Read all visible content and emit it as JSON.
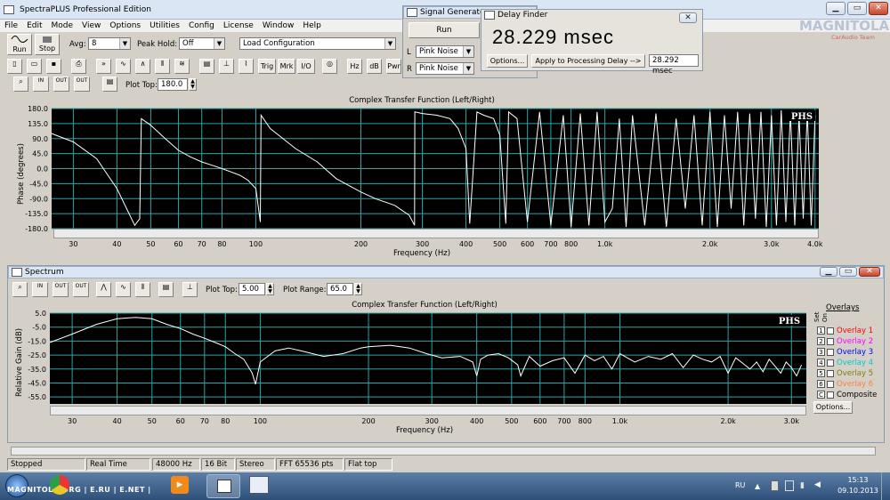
{
  "app": {
    "title": "SpectraPLUS Professional Edition"
  },
  "menu": [
    "File",
    "Edit",
    "Mode",
    "View",
    "Options",
    "Utilities",
    "Config",
    "License",
    "Window",
    "Help"
  ],
  "toolbar": {
    "run_label": "Run",
    "stop_label": "Stop",
    "avg_label": "Avg:",
    "avg_value": "8",
    "peak_hold_label": "Peak Hold:",
    "peak_hold_value": "Off",
    "load_config_value": "Load Configuration",
    "icon_buttons": [
      "Trig",
      "Mrk",
      "I/O",
      "Hz",
      "dB",
      "Pwr"
    ]
  },
  "signal_generator": {
    "title": "Signal Generator",
    "run_label": "Run",
    "left_label": "L",
    "right_label": "R",
    "left_value": "Pink Noise",
    "right_value": "Pink Noise"
  },
  "delay_finder": {
    "title": "Delay Finder",
    "value": "28.229 msec",
    "options_label": "Options...",
    "apply_label": "Apply to Processing Delay -->",
    "apply_value": "28.292 msec"
  },
  "watermark": {
    "line1": "MAGNITOLA",
    "line2": "CarAudio Team"
  },
  "phase_plot": {
    "plot_top_label": "Plot Top:",
    "plot_top_value": "180.0",
    "zoom_buttons": [
      "IN",
      "OUT",
      "OUT"
    ]
  },
  "spectrum": {
    "window_title": "Spectrum",
    "plot_top_label": "Plot Top:",
    "plot_top_value": "5.00",
    "plot_range_label": "Plot Range:",
    "plot_range_value": "65.0",
    "options_label": "Options...",
    "overlays_title": "Overlays",
    "set_label": "Set",
    "on_label": "On",
    "overlays": [
      {
        "set": "1",
        "name": "Overlay 1",
        "color": "#ff0000"
      },
      {
        "set": "2",
        "name": "Overlay 2",
        "color": "#ff00ff"
      },
      {
        "set": "3",
        "name": "Overlay 3",
        "color": "#0000ff"
      },
      {
        "set": "4",
        "name": "Overlay 4",
        "color": "#00c8c8"
      },
      {
        "set": "5",
        "name": "Overlay 5",
        "color": "#808000"
      },
      {
        "set": "6",
        "name": "Overlay 6",
        "color": "#ff8040"
      },
      {
        "set": "C",
        "name": "Composite",
        "color": "#000000"
      }
    ]
  },
  "chart_data": [
    {
      "type": "line",
      "title": "Complex Transfer Function (Left/Right)",
      "xlabel": "Frequency (Hz)",
      "ylabel": "Phase (degrees)",
      "xscale": "log",
      "xlim": [
        26,
        4100
      ],
      "ylim": [
        -180,
        180
      ],
      "yticks": [
        "180.0",
        "135.0",
        "90.0",
        "45.0",
        "0.0",
        "-45.0",
        "-90.0",
        "-135.0",
        "-180.0"
      ],
      "xticks": [
        "30",
        "40",
        "50",
        "60",
        "70",
        "80",
        "100",
        "200",
        "300",
        "400",
        "500",
        "600",
        "700",
        "800",
        "1.0k",
        "2.0k",
        "3.0k",
        "4.0k"
      ],
      "xtick_values": [
        30,
        40,
        50,
        60,
        70,
        80,
        100,
        200,
        300,
        400,
        500,
        600,
        700,
        800,
        1000,
        2000,
        3000,
        4000
      ],
      "badge": "PHS",
      "series": [
        {
          "x": [
            26,
            30,
            35,
            40,
            45,
            46.5,
            47,
            50,
            55,
            60,
            65,
            70,
            75,
            80,
            85,
            90,
            95,
            100,
            103,
            103.5,
            110,
            130,
            150,
            170,
            200,
            220,
            250,
            275,
            285,
            285.5,
            300,
            330,
            360,
            380,
            400,
            410,
            430,
            450,
            480,
            500,
            520,
            530,
            560,
            600,
            650,
            700,
            760,
            800,
            850,
            900,
            950,
            1000,
            1050,
            1100,
            1150,
            1200,
            1300,
            1400,
            1500,
            1600,
            1700,
            1800,
            1900,
            2000,
            2100,
            2200,
            2300,
            2400,
            2500,
            2600,
            2700,
            2800,
            2900,
            3000,
            3100,
            3200,
            3300,
            3400,
            3500,
            3600,
            3700,
            3800,
            3900,
            4000
          ],
          "y": [
            105,
            80,
            30,
            -60,
            -170,
            -150,
            150,
            130,
            90,
            55,
            35,
            20,
            10,
            0,
            -10,
            -20,
            -35,
            -60,
            -160,
            160,
            120,
            60,
            20,
            -30,
            -70,
            -90,
            -110,
            -140,
            -170,
            170,
            165,
            160,
            150,
            120,
            60,
            -165,
            170,
            160,
            150,
            100,
            -165,
            170,
            150,
            -160,
            170,
            -170,
            160,
            -175,
            165,
            -170,
            170,
            -160,
            -120,
            150,
            -175,
            160,
            -170,
            165,
            -175,
            150,
            -120,
            160,
            -170,
            170,
            -175,
            160,
            -120,
            170,
            -170,
            165,
            -150,
            170,
            -175,
            160,
            -170,
            175,
            -160,
            170,
            -170,
            160,
            -150,
            170,
            -170,
            160
          ]
        }
      ]
    },
    {
      "type": "line",
      "title": "Complex Transfer Function (Left/Right)",
      "xlabel": "Frequency (Hz)",
      "ylabel": "Relative Gain (dB)",
      "xscale": "log",
      "xlim": [
        26,
        3300
      ],
      "ylim": [
        -60,
        5
      ],
      "yticks": [
        "5.0",
        "-5.0",
        "-15.0",
        "-25.0",
        "-35.0",
        "-45.0",
        "-55.0"
      ],
      "xticks": [
        "30",
        "40",
        "50",
        "60",
        "70",
        "80",
        "100",
        "200",
        "300",
        "400",
        "500",
        "600",
        "700",
        "800",
        "1.0k",
        "2.0k",
        "3.0k"
      ],
      "xtick_values": [
        30,
        40,
        50,
        60,
        70,
        80,
        100,
        200,
        300,
        400,
        500,
        600,
        700,
        800,
        1000,
        2000,
        3000
      ],
      "badge": "PHS",
      "series": [
        {
          "x": [
            26,
            30,
            35,
            40,
            45,
            50,
            55,
            60,
            65,
            70,
            75,
            80,
            85,
            90,
            95,
            97,
            100,
            110,
            120,
            130,
            150,
            170,
            190,
            200,
            230,
            260,
            290,
            320,
            360,
            390,
            400,
            410,
            430,
            460,
            490,
            520,
            530,
            560,
            600,
            650,
            700,
            750,
            800,
            850,
            900,
            950,
            1000,
            1100,
            1200,
            1300,
            1400,
            1500,
            1600,
            1700,
            1800,
            1900,
            2000,
            2100,
            2200,
            2300,
            2400,
            2500,
            2600,
            2700,
            2800,
            2900,
            3000,
            3100,
            3200
          ],
          "y": [
            -16,
            -10,
            -3,
            1,
            2,
            1,
            -3,
            -6,
            -10,
            -13,
            -16,
            -19,
            -24,
            -28,
            -38,
            -46,
            -30,
            -22,
            -20,
            -22,
            -26,
            -24,
            -20,
            -19,
            -18,
            -20,
            -24,
            -27,
            -26,
            -30,
            -40,
            -28,
            -25,
            -24,
            -27,
            -32,
            -40,
            -26,
            -33,
            -29,
            -27,
            -38,
            -25,
            -29,
            -26,
            -35,
            -24,
            -30,
            -26,
            -28,
            -24,
            -34,
            -25,
            -28,
            -30,
            -26,
            -38,
            -27,
            -31,
            -35,
            -30,
            -37,
            -28,
            -33,
            -38,
            -30,
            -34,
            -40,
            -32
          ]
        }
      ]
    }
  ],
  "status_bar": [
    "Stopped",
    "Real Time",
    "48000 Hz",
    "16 Bit",
    "Stereo",
    "FFT 65536 pts",
    "Flat top"
  ],
  "taskbar": {
    "language": "RU",
    "time": "15:13",
    "date": "09.10.2013",
    "watermark_text": "MAGNITOLA.ORG | E.RU | E.NET |"
  }
}
